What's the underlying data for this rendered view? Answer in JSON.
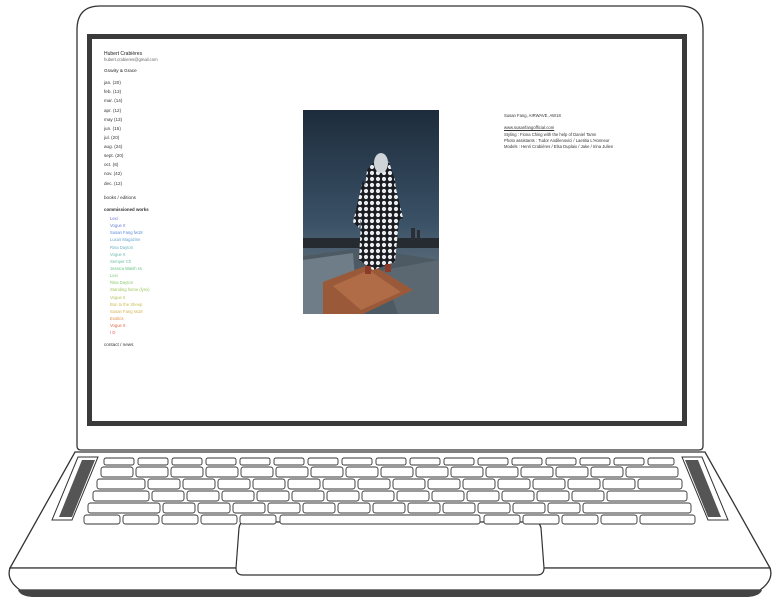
{
  "site": {
    "name": "Hubert Crabières",
    "email": "hubert.crabieres@gmail.com",
    "project": "Gravity & Grace"
  },
  "months": [
    "jan. (20)",
    "feb. (13)",
    "mar. (14)",
    "apr. (12)",
    "may (13)",
    "jun. (15)",
    "jul. (20)",
    "aug. (24)",
    "sept. (20)",
    "oct. (6)",
    "nov. (42)",
    "dec. (12)"
  ],
  "nav": {
    "books": "books / editions",
    "commissioned_title": "commissioned works",
    "contact": "contact / news"
  },
  "commissioned": [
    {
      "label": "Lexi",
      "color": "#6b6bd6"
    },
    {
      "label": "Vogue It",
      "color": "#6b7fd6"
    },
    {
      "label": "Susan Fang fw18",
      "color": "#5a8ad8"
    },
    {
      "label": "Luxus Magazine",
      "color": "#6aa6cf"
    },
    {
      "label": "Rina Dayton",
      "color": "#69b2c3"
    },
    {
      "label": "Vogue It",
      "color": "#6bbbb0"
    },
    {
      "label": "Semper Ch",
      "color": "#6cc0a0"
    },
    {
      "label": "Jessica Walsh ss",
      "color": "#6cc48a"
    },
    {
      "label": "Lexi",
      "color": "#7ac57a"
    },
    {
      "label": "Rina Dayton",
      "color": "#8ac86c"
    },
    {
      "label": "Standing home (lynx)",
      "color": "#9ec760"
    },
    {
      "label": "Vogue It",
      "color": "#b3c35a"
    },
    {
      "label": "Bon to the Sheep",
      "color": "#c6bd54"
    },
    {
      "label": "Susan Fang ss18",
      "color": "#d4b04e"
    },
    {
      "label": "Exotics",
      "color": "#e08e47"
    },
    {
      "label": "Vogue It",
      "color": "#e06a44"
    },
    {
      "label": "I D",
      "color": "#e35d5d"
    }
  ],
  "info": {
    "title": "Susan Fang, AIRWAVE, AW18",
    "link": "www.susanfangofficial.com",
    "styling": "Styling : Fiona Ching with the help of Daniel Tamn",
    "assistants": "Photo assistants : Tudor Andilenovici / Laetitia L'Honneur",
    "models": "Models : Henri Crabières / Elsa Duplaix / Jake / Irina Julien"
  }
}
